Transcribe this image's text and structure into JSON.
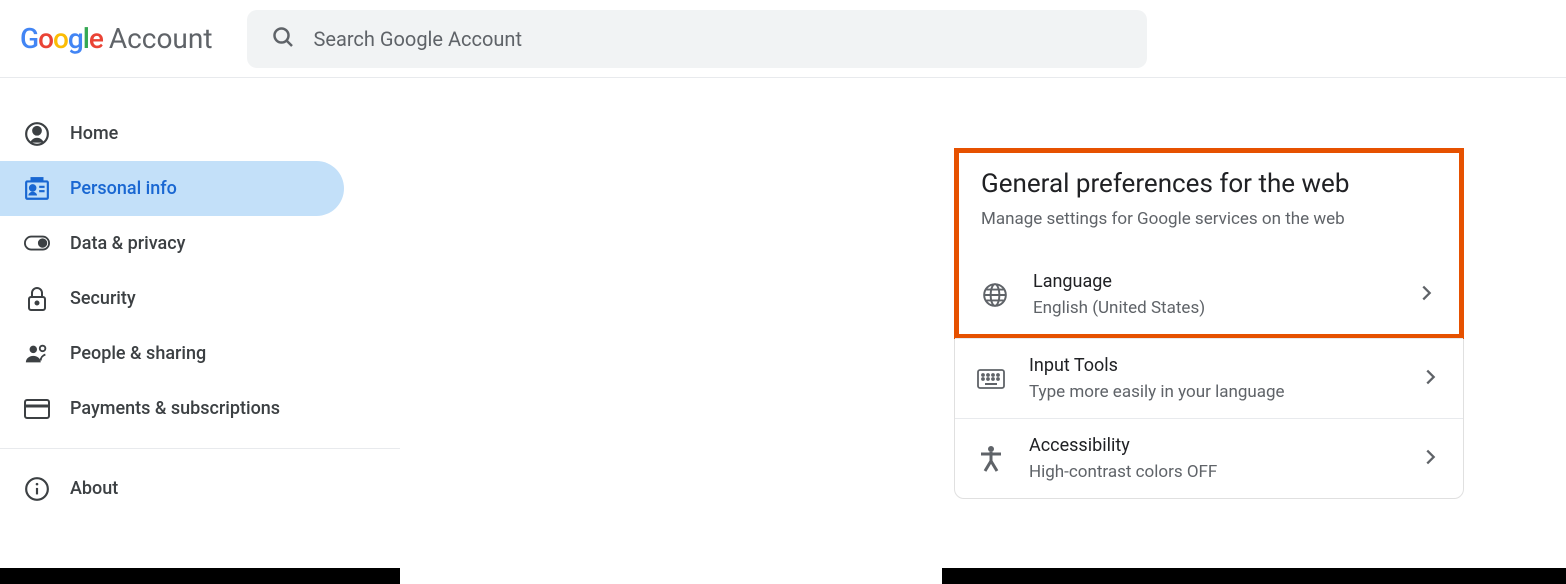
{
  "header": {
    "logo_account_label": "Account",
    "search_placeholder": "Search Google Account"
  },
  "sidebar": {
    "items": [
      {
        "label": "Home"
      },
      {
        "label": "Personal info"
      },
      {
        "label": "Data & privacy"
      },
      {
        "label": "Security"
      },
      {
        "label": "People & sharing"
      },
      {
        "label": "Payments & subscriptions"
      },
      {
        "label": "About"
      }
    ]
  },
  "card": {
    "title": "General preferences for the web",
    "subtitle": "Manage settings for Google services on the web",
    "rows": [
      {
        "title": "Language",
        "desc": "English (United States)"
      },
      {
        "title": "Input Tools",
        "desc": "Type more easily in your language"
      },
      {
        "title": "Accessibility",
        "desc": "High-contrast colors OFF"
      }
    ]
  }
}
